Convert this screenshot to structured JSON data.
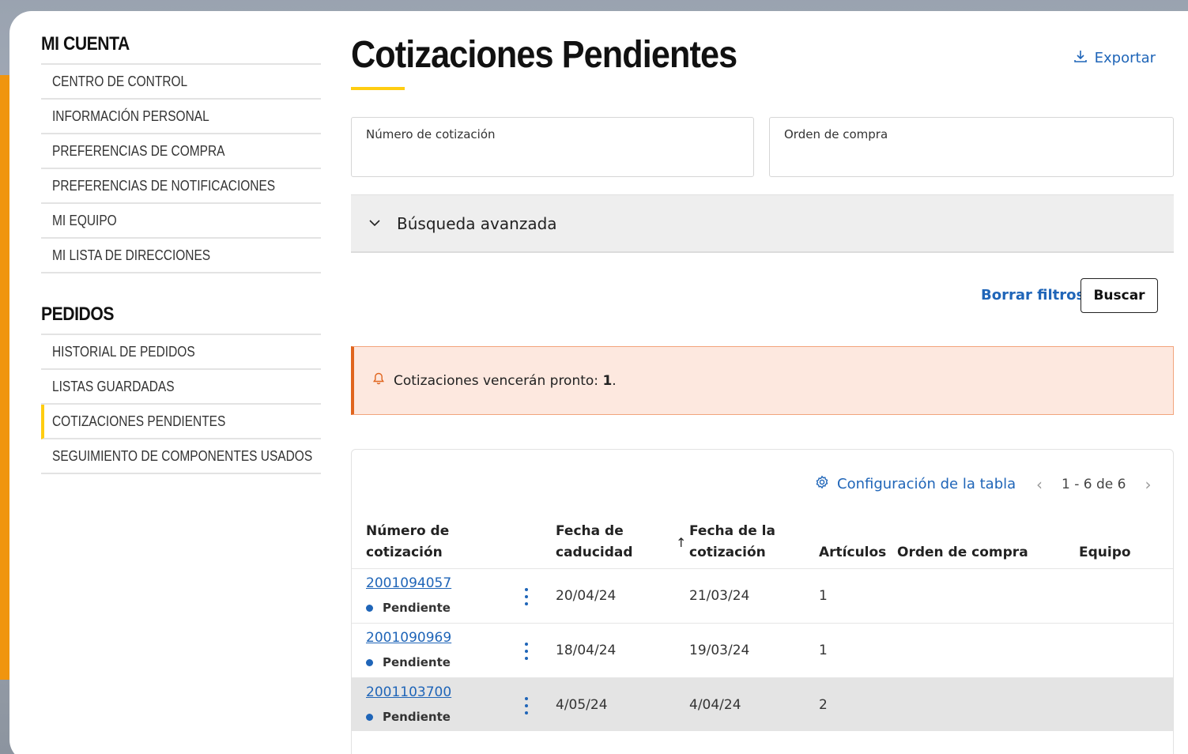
{
  "sidebar": {
    "account_heading": "MI CUENTA",
    "account_items": [
      {
        "label": "CENTRO DE CONTROL"
      },
      {
        "label": "INFORMACIÓN PERSONAL"
      },
      {
        "label": "PREFERENCIAS DE COMPRA"
      },
      {
        "label": "PREFERENCIAS DE NOTIFICACIONES"
      },
      {
        "label": "MI EQUIPO"
      },
      {
        "label": "MI LISTA DE DIRECCIONES"
      }
    ],
    "orders_heading": "PEDIDOS",
    "orders_items": [
      {
        "label": "HISTORIAL DE PEDIDOS"
      },
      {
        "label": "LISTAS GUARDADAS"
      },
      {
        "label": "COTIZACIONES PENDIENTES",
        "active": true
      },
      {
        "label": "SEGUIMIENTO DE COMPONENTES USADOS"
      }
    ]
  },
  "header": {
    "title": "Cotizaciones Pendientes",
    "export_label": "Exportar",
    "export_icon": "download-icon"
  },
  "filters": {
    "quote_number_label": "Número de cotización",
    "purchase_order_label": "Orden de compra",
    "advanced_search_label": "Búsqueda avanzada",
    "clear_label": "Borrar filtros",
    "search_label": "Buscar"
  },
  "alert": {
    "text": "Cotizaciones vencerán pronto: ",
    "count": "1",
    "suffix": ".",
    "icon": "bell-icon"
  },
  "table": {
    "config_label": "Configuración de la tabla",
    "config_icon": "gear-icon",
    "pagination": "1 - 6 de 6",
    "columns": {
      "quote_number_1": "Número de",
      "quote_number_2": "cotización",
      "expiry_1": "Fecha de",
      "expiry_2": "caducidad",
      "quote_date_1": "Fecha de la",
      "quote_date_2": "cotización",
      "items": "Artículos",
      "purchase_order": "Orden de compra",
      "equipment": "Equipo"
    },
    "rows": [
      {
        "number": "2001094057",
        "status": "Pendiente",
        "expiry": "20/04/24",
        "date": "21/03/24",
        "items": "1",
        "po": "",
        "equipment": ""
      },
      {
        "number": "2001090969",
        "status": "Pendiente",
        "expiry": "18/04/24",
        "date": "19/03/24",
        "items": "1",
        "po": "",
        "equipment": ""
      },
      {
        "number": "2001103700",
        "status": "Pendiente",
        "expiry": "4/05/24",
        "date": "4/04/24",
        "items": "2",
        "po": "",
        "equipment": ""
      }
    ]
  },
  "colors": {
    "accent_yellow": "#ffcd11",
    "link_blue": "#1f65b8",
    "alert_bg": "#fde8df",
    "alert_border": "#e0651e"
  }
}
